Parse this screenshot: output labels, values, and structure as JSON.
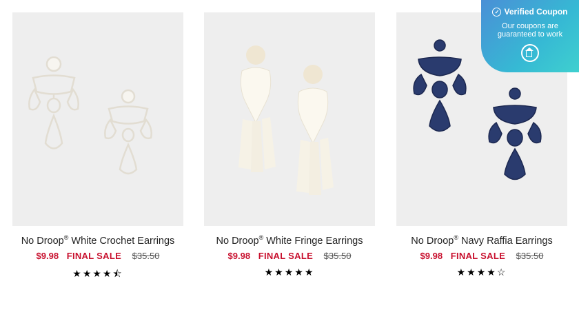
{
  "products": [
    {
      "name": "No Droop",
      "reg": "®",
      "name_rest": " White Crochet Earrings",
      "price": "$9.98",
      "sale_label": "FINAL SALE",
      "original_price": "$35.50",
      "stars": "★★★★⯪",
      "rating": 4.5
    },
    {
      "name": "No Droop",
      "reg": "®",
      "name_rest": " White Fringe Earrings",
      "price": "$9.98",
      "sale_label": "FINAL SALE",
      "original_price": "$35.50",
      "stars": "★★★★★",
      "rating": 5
    },
    {
      "name": "No Droop",
      "reg": "®",
      "name_rest": " Navy Raffia Earrings",
      "price": "$9.98",
      "sale_label": "FINAL SALE",
      "original_price": "$35.50",
      "stars": "★★★★☆",
      "rating": 4
    }
  ],
  "coupon_badge": {
    "title": "Verified Coupon",
    "check_icon": "✓",
    "subtitle": "Our coupons are guaranteed to work",
    "icon": "home-icon"
  },
  "colors": {
    "sale_red": "#c8102e",
    "badge_start": "#4a8fd6",
    "badge_end": "#3fd0cf",
    "navy": "#2a3b6e"
  }
}
